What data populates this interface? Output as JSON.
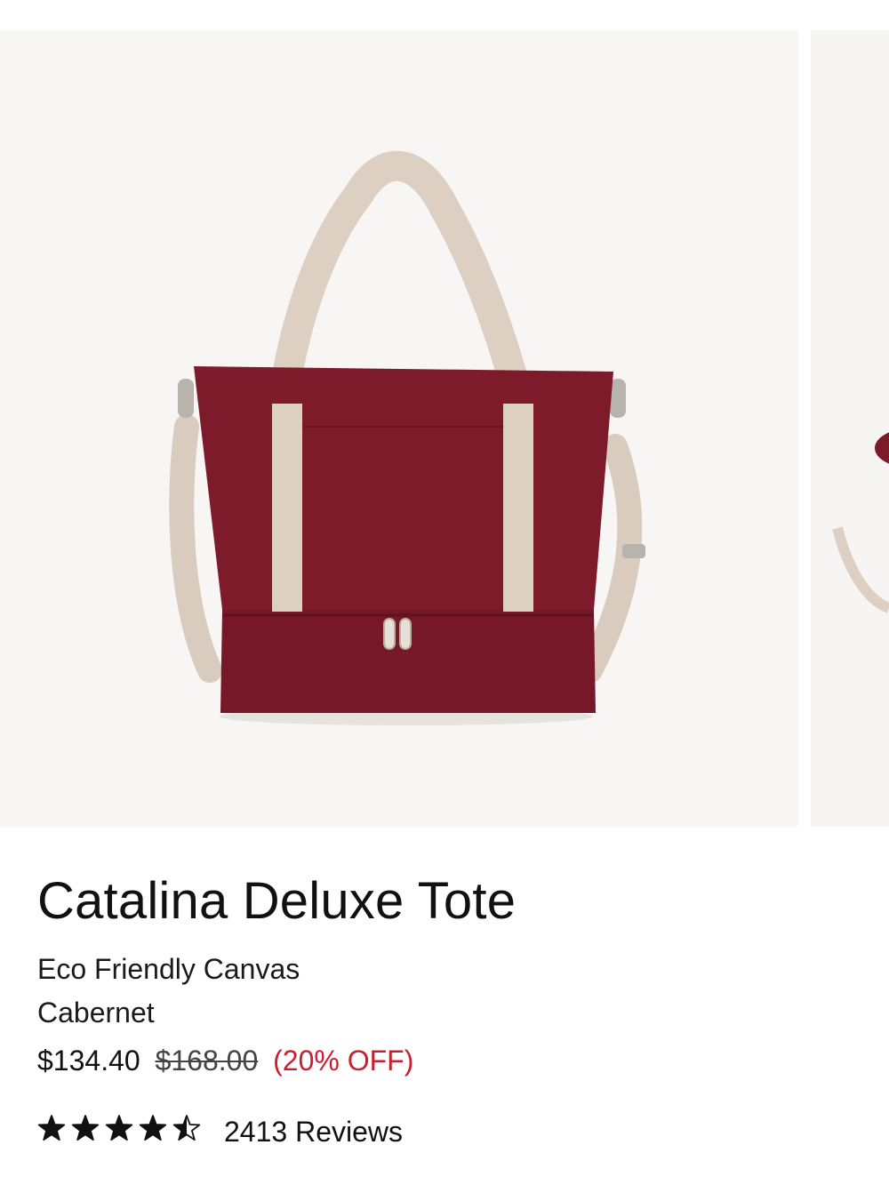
{
  "product": {
    "title": "Catalina Deluxe Tote",
    "material": "Eco Friendly Canvas",
    "color_name": "Cabernet",
    "price": {
      "sale": "$134.40",
      "original": "$168.00",
      "discount": "(20% OFF)"
    },
    "rating": {
      "value": 4.5,
      "max": 5,
      "reviews_label": "2413 Reviews"
    }
  },
  "images": {
    "main": "product-photo-tote-front",
    "next": "product-photo-next-partial"
  },
  "colors": {
    "canvas": "#7d1b2a",
    "strap": "#ddd0c2",
    "sale_accent": "#c8202f"
  }
}
